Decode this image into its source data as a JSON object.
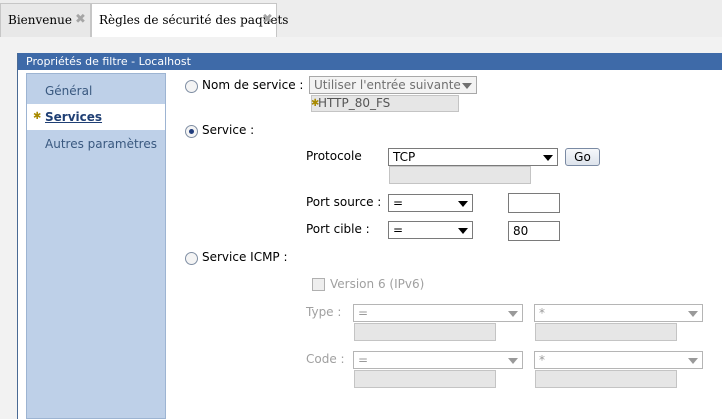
{
  "tabs": [
    {
      "label": "Bienvenue",
      "close": "✖"
    },
    {
      "label": "Règles de sécurité des paquets",
      "close": "✖"
    }
  ],
  "panel": {
    "title": "Propriétés de filtre - Localhost"
  },
  "sidebar": {
    "items": [
      {
        "label": "Général"
      },
      {
        "label": "Services"
      },
      {
        "label": "Autres paramètres"
      }
    ]
  },
  "service_name": {
    "label": "Nom de service :",
    "select_value": "Utiliser l'entrée suivante",
    "entry_value": "HTTP_80_FS"
  },
  "service": {
    "label": "Service :",
    "protocol_label": "Protocole",
    "protocol_value": "TCP",
    "go_label": "Go",
    "port_source_label": "Port source :",
    "port_source_op": "=",
    "port_source_value": "",
    "port_cible_label": "Port cible :",
    "port_cible_op": "=",
    "port_cible_value": "80"
  },
  "icmp": {
    "label": "Service ICMP :",
    "version_label": "Version 6 (IPv6)",
    "type_label": "Type :",
    "type_op": "=",
    "type_value": "*",
    "code_label": "Code :",
    "code_op": "=",
    "code_value": "*"
  },
  "icons": {
    "required_marker": "star-icon",
    "close": "close-icon",
    "dropdown": "chevron-down-icon"
  },
  "colors": {
    "title_bar": "#3e6aa8",
    "sidebar": "#bed0e8",
    "selected_radio": "#203c7c"
  }
}
